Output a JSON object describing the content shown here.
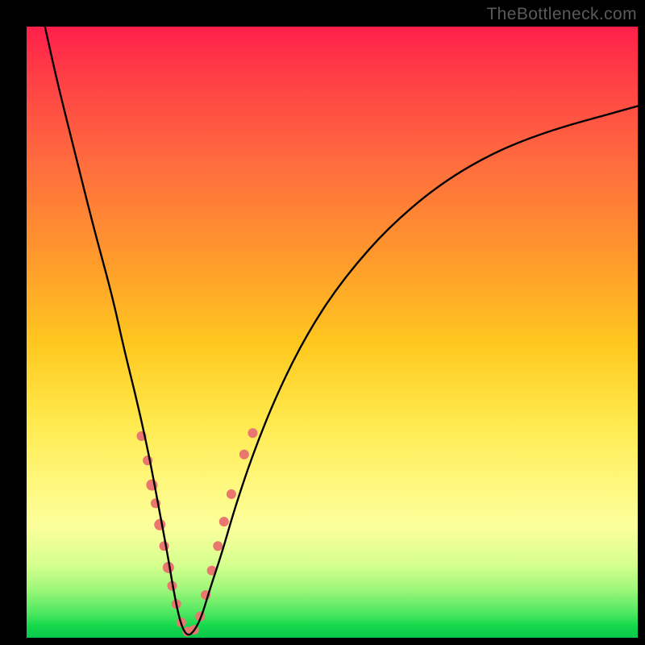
{
  "watermark": "TheBottleneck.com",
  "chart_data": {
    "type": "line",
    "title": "",
    "xlabel": "",
    "ylabel": "",
    "xlim": [
      0,
      100
    ],
    "ylim": [
      0,
      100
    ],
    "note": "Single V-shaped bottleneck curve over a red-to-green vertical gradient. Axis ticks and numeric labels are not shown in the image; values are estimated from pixel positions on a 0–100 normalized scale. Salmon-colored dots mark sample points clustered near the curve's minimum.",
    "series": [
      {
        "name": "bottleneck-curve",
        "x": [
          3,
          5,
          8,
          11,
          14,
          16,
          18,
          20,
          21.5,
          23,
          24,
          25,
          26,
          27,
          28.5,
          30,
          32,
          34,
          37,
          41,
          46,
          52,
          60,
          70,
          82,
          100
        ],
        "y": [
          100,
          91,
          79,
          67,
          56,
          47,
          39,
          30,
          22,
          14,
          8,
          3,
          0.5,
          0.5,
          3,
          8,
          14,
          21,
          30,
          40,
          50,
          59,
          68,
          76,
          82,
          87
        ]
      }
    ],
    "dots": {
      "name": "sample-points",
      "color": "#e9766f",
      "points": [
        {
          "x": 18.8,
          "y": 33,
          "r": 6
        },
        {
          "x": 19.8,
          "y": 29,
          "r": 6
        },
        {
          "x": 20.5,
          "y": 25,
          "r": 7
        },
        {
          "x": 21.1,
          "y": 22,
          "r": 6
        },
        {
          "x": 21.8,
          "y": 18.5,
          "r": 7
        },
        {
          "x": 22.5,
          "y": 15,
          "r": 6
        },
        {
          "x": 23.2,
          "y": 11.5,
          "r": 7
        },
        {
          "x": 23.8,
          "y": 8.5,
          "r": 6
        },
        {
          "x": 24.5,
          "y": 5.5,
          "r": 6
        },
        {
          "x": 25.3,
          "y": 2.5,
          "r": 6
        },
        {
          "x": 26.3,
          "y": 1.0,
          "r": 6
        },
        {
          "x": 27.4,
          "y": 1.3,
          "r": 6
        },
        {
          "x": 28.4,
          "y": 3.5,
          "r": 6
        },
        {
          "x": 29.3,
          "y": 7,
          "r": 6
        },
        {
          "x": 30.3,
          "y": 11,
          "r": 6
        },
        {
          "x": 31.3,
          "y": 15,
          "r": 6
        },
        {
          "x": 32.3,
          "y": 19,
          "r": 6
        },
        {
          "x": 33.5,
          "y": 23.5,
          "r": 6
        },
        {
          "x": 35.6,
          "y": 30,
          "r": 6
        },
        {
          "x": 37.0,
          "y": 33.5,
          "r": 6
        }
      ]
    }
  }
}
